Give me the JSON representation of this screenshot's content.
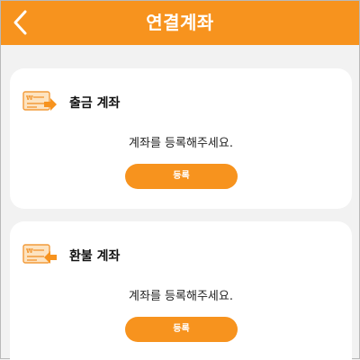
{
  "header": {
    "title": "연결계좌",
    "back_icon": "chevron-left-icon"
  },
  "colors": {
    "accent": "#f7931e",
    "background": "#f2f2f2",
    "card": "#ffffff"
  },
  "cards": [
    {
      "icon": "bank-account-icon",
      "title": "출금 계좌",
      "message": "계좌를 등록해주세요.",
      "button_label": "등록"
    },
    {
      "icon": "bank-account-icon",
      "title": "환불 계좌",
      "message": "계좌를 등록해주세요.",
      "button_label": "등록"
    }
  ]
}
